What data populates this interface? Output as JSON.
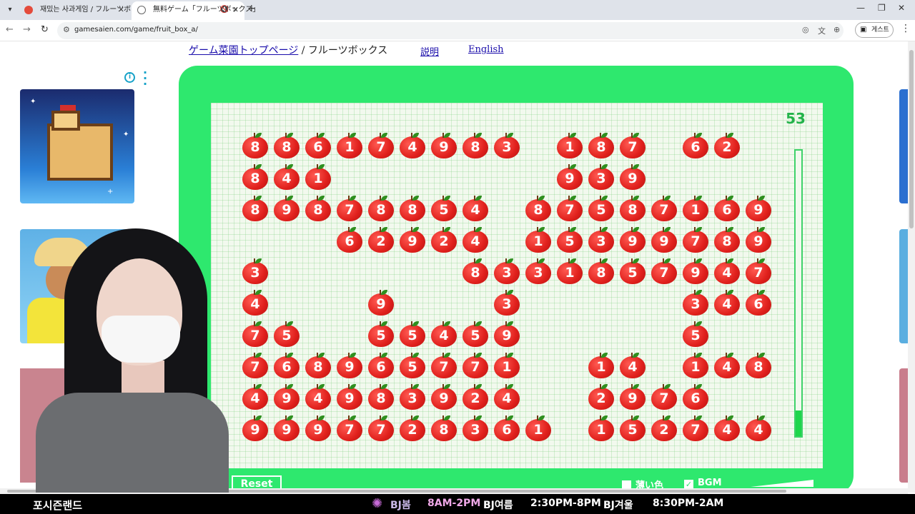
{
  "browser": {
    "tabs": [
      {
        "title": "재밌는 사과게임 / フルーツボック"
      },
      {
        "title": "無料ゲーム「フルーツボックス」"
      }
    ],
    "url": "gamesaien.com/game/fruit_box_a/",
    "profile_label": "게스트"
  },
  "page": {
    "breadcrumb_link": "ゲーム菜園トップページ",
    "breadcrumb_current": " / フルーツボックス",
    "nav_help": "説明",
    "nav_english": "English"
  },
  "game": {
    "score": "53",
    "time_remaining_fraction": 0.09,
    "reset_label": "Reset",
    "light_color_label": "薄い色",
    "light_color_checked": false,
    "bgm_label": "BGM",
    "bgm_checked": true,
    "grid": [
      [
        "8",
        "8",
        "6",
        "1",
        "7",
        "4",
        "9",
        "8",
        "3",
        "",
        "1",
        "8",
        "7",
        "",
        "6",
        "2",
        ""
      ],
      [
        "8",
        "4",
        "1",
        "",
        "",
        "",
        "",
        "",
        "",
        "",
        "9",
        "3",
        "9",
        "",
        "",
        "",
        ""
      ],
      [
        "8",
        "9",
        "8",
        "7",
        "8",
        "8",
        "5",
        "4",
        "",
        "8",
        "7",
        "5",
        "8",
        "7",
        "1",
        "6",
        "9"
      ],
      [
        "",
        "",
        "",
        "6",
        "2",
        "9",
        "2",
        "4",
        "",
        "1",
        "5",
        "3",
        "9",
        "9",
        "7",
        "8",
        "9"
      ],
      [
        "3",
        "",
        "",
        "",
        "",
        "",
        "",
        "8",
        "3",
        "3",
        "1",
        "8",
        "5",
        "7",
        "9",
        "4",
        "7"
      ],
      [
        "4",
        "",
        "",
        "",
        "9",
        "",
        "",
        "",
        "3",
        "",
        "",
        "",
        "",
        "",
        "3",
        "4",
        "6"
      ],
      [
        "7",
        "5",
        "",
        "",
        "5",
        "5",
        "4",
        "5",
        "9",
        "",
        "",
        "",
        "",
        "",
        "5",
        "",
        ""
      ],
      [
        "7",
        "6",
        "8",
        "9",
        "6",
        "5",
        "7",
        "7",
        "1",
        "",
        "",
        "1",
        "4",
        "",
        "1",
        "4",
        "8"
      ],
      [
        "4",
        "9",
        "4",
        "9",
        "8",
        "3",
        "9",
        "2",
        "4",
        "",
        "",
        "2",
        "9",
        "7",
        "6",
        "",
        ""
      ],
      [
        "9",
        "9",
        "9",
        "7",
        "7",
        "2",
        "8",
        "3",
        "6",
        "1",
        "",
        "1",
        "5",
        "2",
        "7",
        "4",
        "4"
      ]
    ]
  },
  "stream": {
    "streamer": "포시즌랜드",
    "schedule": [
      {
        "label": "BJ봄",
        "time": "8AM-2PM"
      },
      {
        "label": "BJ여름",
        "time": "2:30PM-8PM"
      },
      {
        "label": "BJ겨울",
        "time": "8:30PM-2AM"
      }
    ]
  }
}
